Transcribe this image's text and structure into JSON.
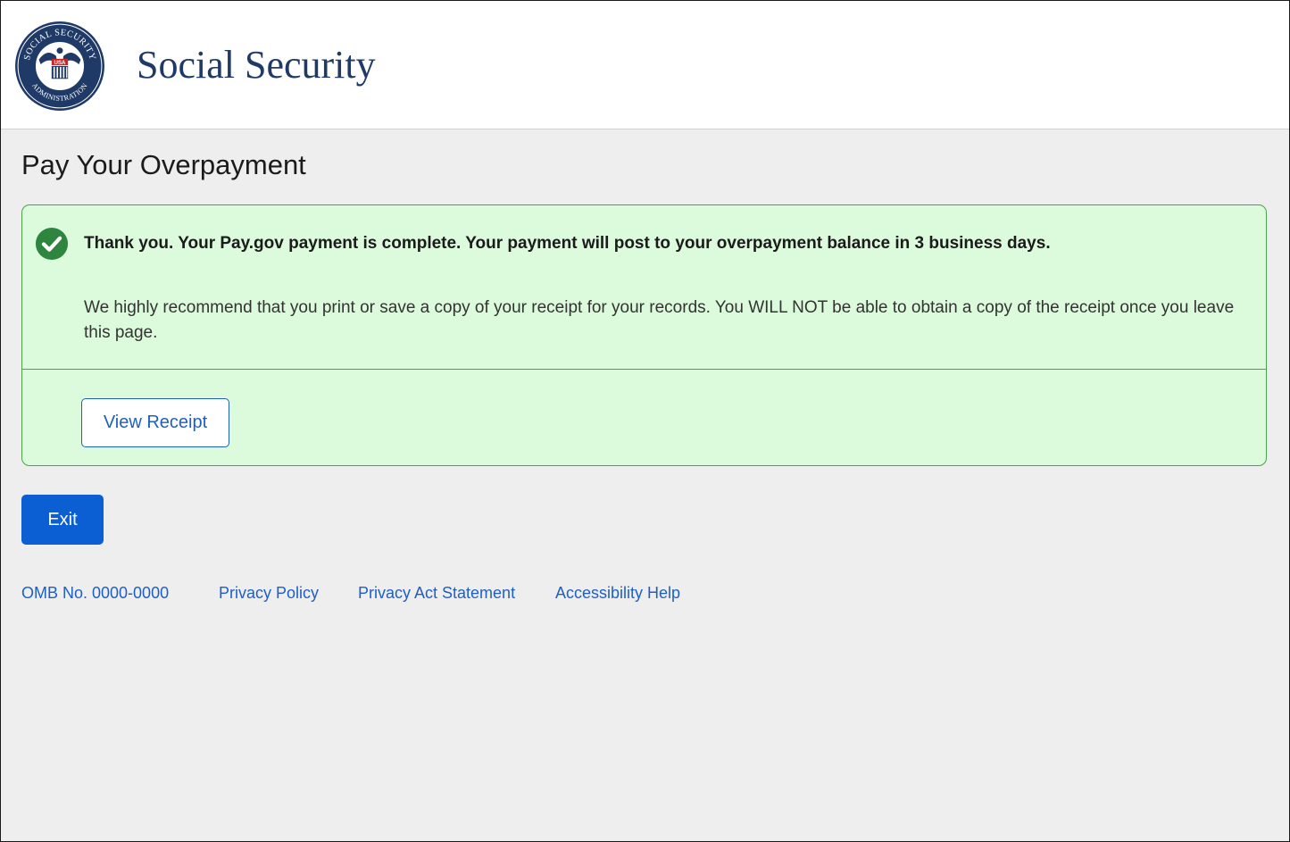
{
  "header": {
    "site_title": "Social Security",
    "seal_text": {
      "top": "SOCIAL SECURITY",
      "bottom": "ADMINISTRATION",
      "center": "USA"
    }
  },
  "page": {
    "title": "Pay Your Overpayment"
  },
  "alert": {
    "heading": "Thank you. Your Pay.gov payment is complete.  Your payment will post to your overpayment balance in 3 business days.",
    "body": "We highly recommend that you print or save a copy of your receipt for your records. You WILL NOT be able to obtain a copy of the receipt once you leave this page.",
    "receipt_button_label": "View Receipt"
  },
  "actions": {
    "exit_label": "Exit"
  },
  "footer": {
    "links": [
      {
        "label": "OMB No. 0000-0000"
      },
      {
        "label": "Privacy Policy"
      },
      {
        "label": "Privacy Act Statement"
      },
      {
        "label": "Accessibility Help"
      }
    ]
  },
  "colors": {
    "brand_navy": "#1f3a66",
    "success_green": "#2e8540",
    "alert_background": "#dcfadc",
    "link_blue": "#1f5fc4",
    "primary_button": "#0b5fd3"
  },
  "icons": {
    "seal": "ssa-seal-icon",
    "success": "check-circle-icon"
  }
}
